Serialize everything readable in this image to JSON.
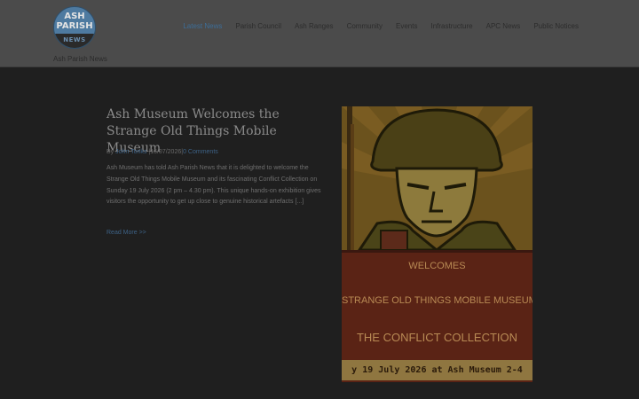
{
  "site": {
    "logo": {
      "line1": "ASH",
      "line2": "PARISH",
      "line3": "NEWS"
    },
    "name": "Ash Parish News"
  },
  "nav": [
    {
      "label": "Latest News",
      "active": true
    },
    {
      "label": "Parish Council",
      "active": false
    },
    {
      "label": "Ash Ranges",
      "active": false
    },
    {
      "label": "Community",
      "active": false
    },
    {
      "label": "Events",
      "active": false
    },
    {
      "label": "Infrastructure",
      "active": false
    },
    {
      "label": "APC News",
      "active": false
    },
    {
      "label": "Public Notices",
      "active": false
    }
  ],
  "post": {
    "title": "Ash Museum Welcomes the Strange Old Things Mobile Museum",
    "meta_by": "By",
    "author": "John Tonks",
    "date": "16/07/2026",
    "comments": "0 Comments",
    "excerpt": "Ash Museum has told Ash Parish News that it is delighted to welcome the Strange Old Things Mobile Museum and its fascinating Conflict Collection on Sunday 19 July 2026 (2 pm – 4.30 pm). This unique hands-on exhibition gives visitors the opportunity to get up close to genuine historical artefacts [...]",
    "read_more": "Read More >>"
  },
  "poster": {
    "line1": "WELCOMES",
    "line2": "STRANGE OLD THINGS MOBILE MUSEUM",
    "line3": "THE CONFLICT COLLECTION",
    "line4": "y 19 July 2026 at Ash Museum 2-4"
  },
  "colors": {
    "accent": "#3d6d97",
    "overlay": "#1f1f1f"
  }
}
